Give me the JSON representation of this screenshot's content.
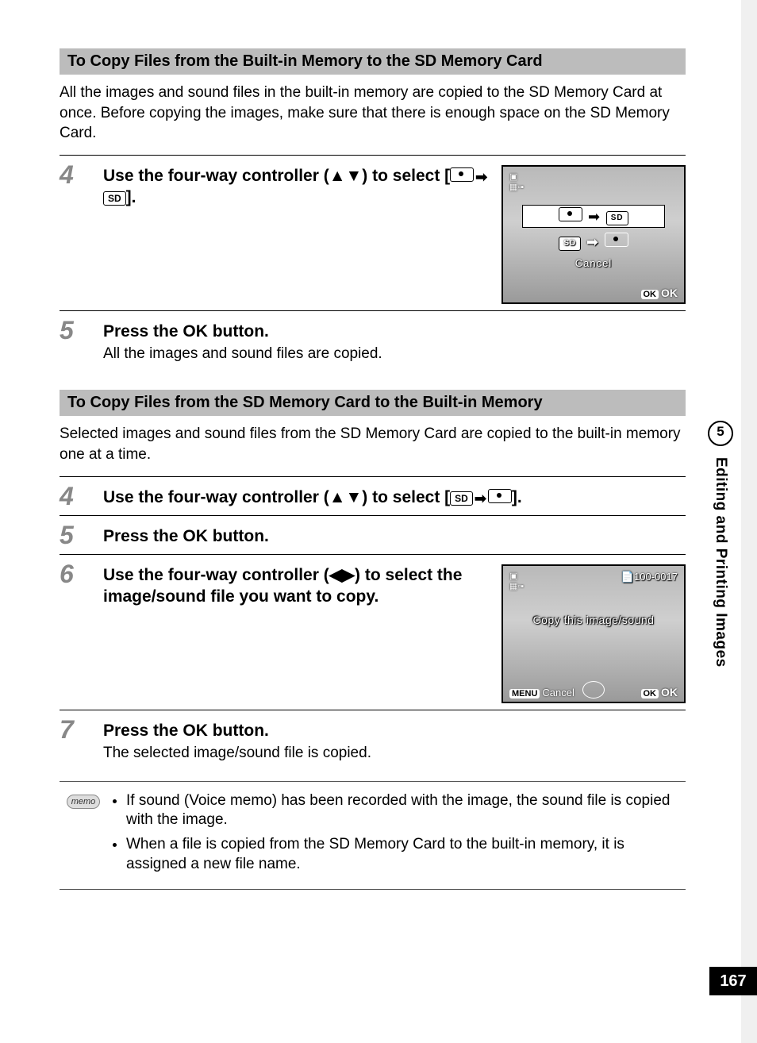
{
  "sidebar": {
    "chapter_number": "5",
    "chapter_title": "Editing and Printing Images",
    "page_number": "167"
  },
  "section1": {
    "header": "To Copy Files from the Built-in Memory to the SD Memory Card",
    "intro": "All the images and sound files in the built-in memory are copied to the SD Memory Card at once. Before copying the images, make sure that there is enough space on the SD Memory Card."
  },
  "steps_a": {
    "s4": {
      "num": "4",
      "title_pre": "Use the four-way controller (",
      "arrows_ud": "▲▼",
      "title_mid": ") to select [",
      "sd_label": "SD",
      "title_post": "]."
    },
    "s5": {
      "num": "5",
      "title_pre": "Press the ",
      "ok": "OK",
      "title_post": " button.",
      "sub": "All the images and sound files are copied."
    }
  },
  "lcd1": {
    "option1_sd": "SD",
    "option2_sd": "SD",
    "cancel": "Cancel",
    "ok_badge": "OK",
    "ok_text": "OK"
  },
  "section2": {
    "header": "To Copy Files from the SD Memory Card to the Built-in Memory",
    "intro": "Selected images and sound files from the SD Memory Card are copied to the built-in memory one at a time."
  },
  "steps_b": {
    "s4": {
      "num": "4",
      "title_pre": "Use the four-way controller (",
      "arrows_ud": "▲▼",
      "title_mid": ") to select [",
      "sd_label": "SD",
      "title_post": "]."
    },
    "s5": {
      "num": "5",
      "title_pre": "Press the ",
      "ok": "OK",
      "title_post": " button."
    },
    "s6": {
      "num": "6",
      "title_pre": "Use the four-way controller (",
      "arrows_lr": "◀▶",
      "title_post": ") to select the image/sound file you want to copy."
    },
    "s7": {
      "num": "7",
      "title_pre": "Press the ",
      "ok": "OK",
      "title_post": " button.",
      "sub": "The selected image/sound file is copied."
    }
  },
  "lcd2": {
    "file_no": "100-0017",
    "center_text": "Copy this image/sound",
    "menu_badge": "MENU",
    "cancel": "Cancel",
    "ok_badge": "OK",
    "ok_text": "OK"
  },
  "memo": {
    "label": "memo",
    "item1": "If sound (Voice memo) has been recorded with the image, the sound file is copied with the image.",
    "item2": "When a file is copied from the SD Memory Card to the built-in memory, it is assigned a new file name."
  }
}
